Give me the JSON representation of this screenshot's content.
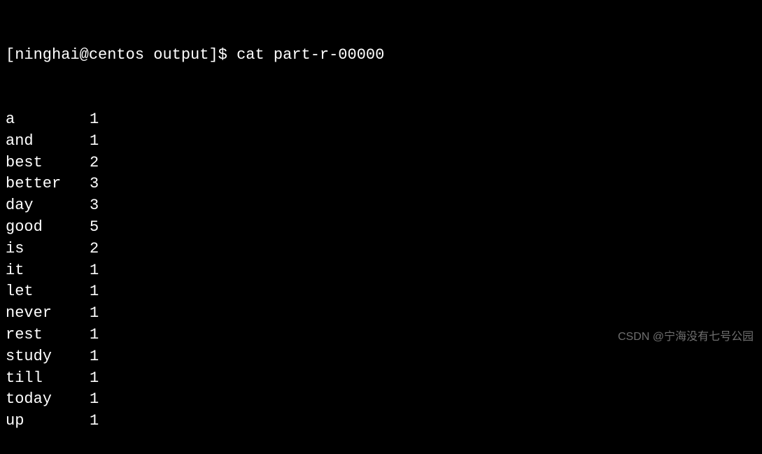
{
  "prompt": {
    "user": "ninghai",
    "host": "centos",
    "dir": "output",
    "symbol": "$",
    "command": "cat part-r-00000"
  },
  "output": [
    {
      "word": "a",
      "count": "1"
    },
    {
      "word": "and",
      "count": "1"
    },
    {
      "word": "best",
      "count": "2"
    },
    {
      "word": "better",
      "count": "3"
    },
    {
      "word": "day",
      "count": "3"
    },
    {
      "word": "good",
      "count": "5"
    },
    {
      "word": "is",
      "count": "2"
    },
    {
      "word": "it",
      "count": "1"
    },
    {
      "word": "let",
      "count": "1"
    },
    {
      "word": "never",
      "count": "1"
    },
    {
      "word": "rest",
      "count": "1"
    },
    {
      "word": "study",
      "count": "1"
    },
    {
      "word": "till",
      "count": "1"
    },
    {
      "word": "today",
      "count": "1"
    },
    {
      "word": "up",
      "count": "1"
    }
  ],
  "watermark": "CSDN @宁海没有七号公园"
}
